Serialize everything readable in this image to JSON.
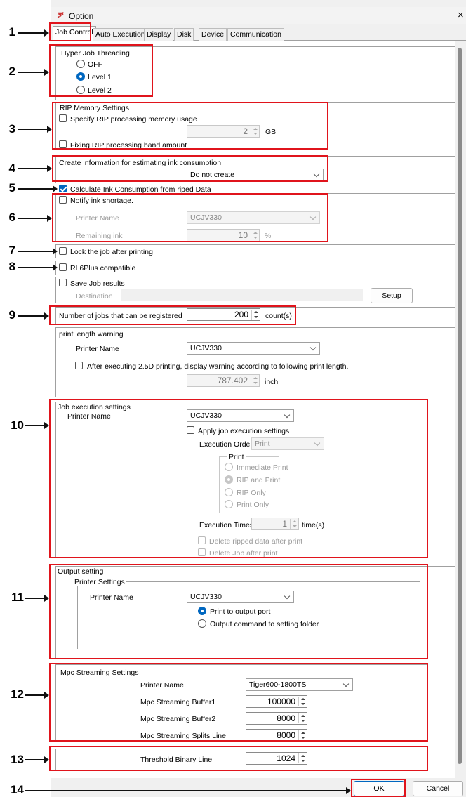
{
  "window": {
    "title": "Option",
    "close_glyph": "×"
  },
  "tabs": [
    {
      "label": "Job Control"
    },
    {
      "label": "Auto Execution"
    },
    {
      "label": "Display"
    },
    {
      "label": "Disk"
    },
    {
      "label": "Device"
    },
    {
      "label": "Communication"
    }
  ],
  "callouts": [
    "1",
    "2",
    "3",
    "4",
    "5",
    "6",
    "7",
    "8",
    "9",
    "10",
    "11",
    "12",
    "13",
    "14"
  ],
  "hyper_job_threading": {
    "title": "Hyper Job Threading",
    "off": "OFF",
    "level1": "Level 1",
    "level2": "Level 2",
    "selected": "Level 1"
  },
  "rip_memory": {
    "title": "RIP Memory Settings",
    "specify_label": "Specify RIP processing memory usage",
    "memory_value": "2",
    "unit": "GB",
    "fixing_label": "Fixing RIP processing band amount"
  },
  "ink_estimate": {
    "title": "Create information for estimating ink consumption",
    "value": "Do not create"
  },
  "calc_ink": {
    "label": "Calculate Ink Consumption from riped Data",
    "checked": true
  },
  "ink_shortage": {
    "label": "Notify ink shortage.",
    "printer_label": "Printer Name",
    "printer_value": "UCJV330",
    "remaining_label": "Remaining ink",
    "remaining_value": "10",
    "unit": "%"
  },
  "lock_job": {
    "label": "Lock the job after printing"
  },
  "rl6plus": {
    "label": "RL6Plus compatible"
  },
  "save_job": {
    "label": "Save Job results",
    "destination_label": "Destination",
    "setup_button": "Setup"
  },
  "jobs_registered": {
    "label": "Number of jobs that can be registered",
    "value": "200",
    "unit": "count(s)"
  },
  "print_length": {
    "title": "print length warning",
    "printer_label": "Printer Name",
    "printer_value": "UCJV330",
    "after_label": "After executing 2.5D printing, display warning according to following print length.",
    "length_value": "787.402",
    "unit": "inch"
  },
  "job_exec": {
    "title": "Job execution settings",
    "printer_label": "Printer Name",
    "printer_value": "UCJV330",
    "apply_label": "Apply job execution settings",
    "order_label": "Execution Order",
    "order_value": "Print",
    "print_group": "Print",
    "opt_immediate": "Immediate Print",
    "opt_rip_print": "RIP and Print",
    "opt_rip_only": "RIP Only",
    "opt_print_only": "Print Only",
    "times_label": "Execution Times",
    "times_value": "1",
    "times_unit": "time(s)",
    "delete_ripped": "Delete ripped data after print",
    "delete_job": "Delete Job after print"
  },
  "output": {
    "title": "Output setting",
    "printer_settings": "Printer Settings",
    "printer_label": "Printer Name",
    "printer_value": "UCJV330",
    "opt_port": "Print to output port",
    "opt_folder": "Output command to setting folder"
  },
  "mpc": {
    "title": "Mpc Streaming Settings",
    "printer_label": "Printer Name",
    "printer_value": "Tiger600-1800TS",
    "buffer1_label": "Mpc Streaming Buffer1",
    "buffer1_value": "100000",
    "buffer2_label": "Mpc Streaming Buffer2",
    "buffer2_value": "8000",
    "splits_label": "Mpc Streaming Splits Line",
    "splits_value": "8000"
  },
  "threshold": {
    "label": "Threshold Binary Line",
    "value": "1024"
  },
  "buttons": {
    "ok": "OK",
    "cancel": "Cancel"
  },
  "colors": {
    "accent": "#0067c0",
    "callout_box": "#e0141c"
  }
}
